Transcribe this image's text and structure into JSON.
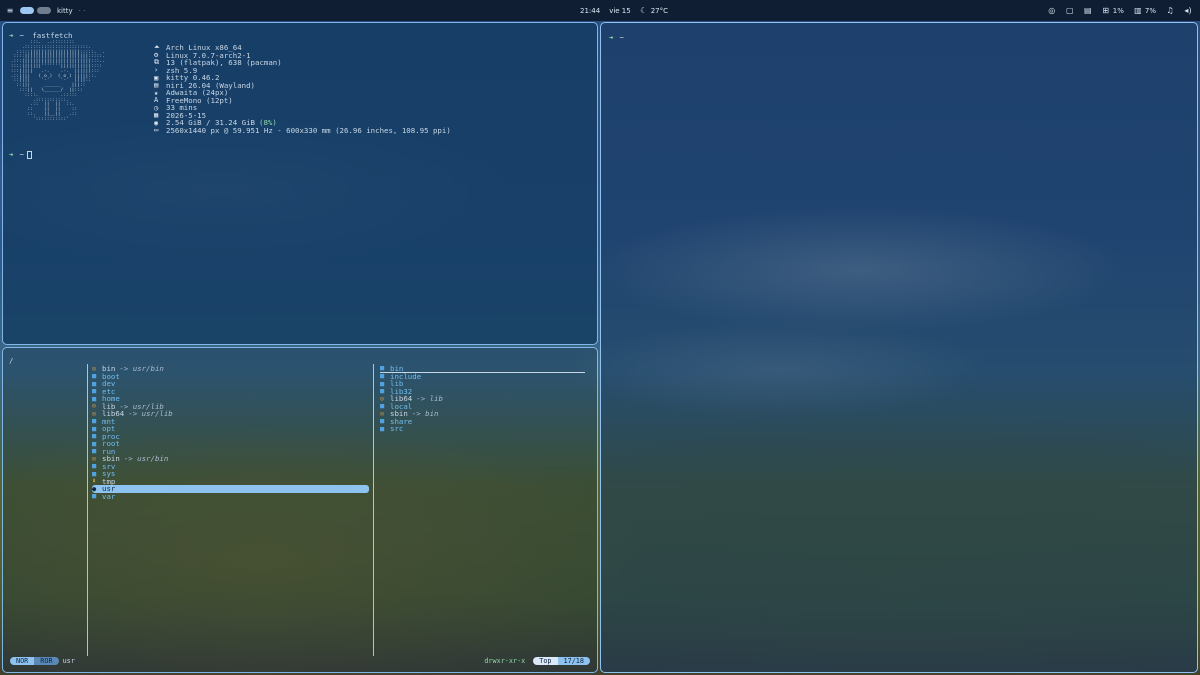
{
  "topbar": {
    "window_title": "kitty",
    "title_sep": "· ·",
    "clock": "21:44",
    "date": "vie 15",
    "weather": "27°C",
    "cpu": "1%",
    "memory": "7%",
    "icons": [
      "menu-icon",
      "screenshot-icon",
      "clipboard-icon",
      "notes-icon",
      "cpu-icon",
      "memory-icon",
      "notification-icon",
      "volume-icon"
    ]
  },
  "terminal_top_left": {
    "prompt_arrow": "➜",
    "prompt_dir": "~",
    "command": "fastfetch",
    "ascii_art": "        :::.  ..::::::::\n     .:::::::::::::::::::::::.\n   :::::||||||||||||||||||:::::.  .\n  ::::|||||||||||||||||||||||:::::.\n .:::|||||||||||||||||||||||||:::..\n ::::|||||||'''''''|||||||||||::::\n :::|||||   .-.    .-.  ||||||:::\n .::||||   ( o )  ( o ) |||||::.\n  ::||||    '-'    '-'  ||||::\n   ::|||     ______    |||::\n    :::||   \\______/  ||:::\n      ::::.        .:::::\n         .:::::::::::.\n        .::  ||  ||  ::.\n       ::    ||  ||    ::\n       ::.   ||__||   .::\n         ':::::::::::'",
    "info": [
      {
        "icon": "arch-icon",
        "glyph": "⏶",
        "text": "Arch Linux x86_64"
      },
      {
        "icon": "kernel-icon",
        "glyph": "⚙",
        "text": "Linux 7.0.7-arch2-1"
      },
      {
        "icon": "packages-icon",
        "glyph": "⧉",
        "text": "13 (flatpak), 638 (pacman)"
      },
      {
        "icon": "shell-icon",
        "glyph": "›",
        "text": "zsh 5.9"
      },
      {
        "icon": "terminal-icon",
        "glyph": "▣",
        "text": "kitty 0.46.2"
      },
      {
        "icon": "wm-icon",
        "glyph": "▤",
        "text": "niri 26.04 (Wayland)"
      },
      {
        "icon": "theme-icon",
        "glyph": "★",
        "text": "Adwaita (24px)"
      },
      {
        "icon": "font-icon",
        "glyph": "A",
        "text": "FreeMono (12pt)"
      },
      {
        "icon": "uptime-icon",
        "glyph": "◷",
        "text": "33 mins"
      },
      {
        "icon": "calendar-icon",
        "glyph": "▦",
        "text": "2026-5-15"
      },
      {
        "icon": "memory-icon",
        "glyph": "◉",
        "text": "2.54 GiB / 31.24 GiB",
        "pct": "(8%)"
      },
      {
        "icon": "display-icon",
        "glyph": "▭",
        "text": "2560x1440 px @ 59.951 Hz - 600x330 mm (26.96 inches, 108.95 ppi)"
      }
    ],
    "prompt2_dir": "~"
  },
  "terminal_right": {
    "prompt_arrow": "➜",
    "prompt_dir": "~"
  },
  "file_manager": {
    "path": "/",
    "parent_entries": [
      {
        "name": "bin",
        "type": "link",
        "target": "-> usr/bin"
      },
      {
        "name": "boot",
        "type": "dir"
      },
      {
        "name": "dev",
        "type": "dir"
      },
      {
        "name": "etc",
        "type": "dir"
      },
      {
        "name": "home",
        "type": "dir"
      },
      {
        "name": "lib",
        "type": "link",
        "target": "-> usr/lib"
      },
      {
        "name": "lib64",
        "type": "link",
        "target": "-> usr/lib"
      },
      {
        "name": "mnt",
        "type": "dir"
      },
      {
        "name": "opt",
        "type": "dir"
      },
      {
        "name": "proc",
        "type": "dir"
      },
      {
        "name": "root",
        "type": "dir"
      },
      {
        "name": "run",
        "type": "dir"
      },
      {
        "name": "sbin",
        "type": "link",
        "target": "-> usr/bin"
      },
      {
        "name": "srv",
        "type": "dir"
      },
      {
        "name": "sys",
        "type": "dir"
      },
      {
        "name": "tmp",
        "type": "tmp"
      },
      {
        "name": "usr",
        "type": "selected"
      },
      {
        "name": "var",
        "type": "dir"
      }
    ],
    "preview_entries": [
      {
        "name": "bin",
        "type": "dir",
        "highlight": true
      },
      {
        "name": "include",
        "type": "dir"
      },
      {
        "name": "lib",
        "type": "dir"
      },
      {
        "name": "lib32",
        "type": "dir"
      },
      {
        "name": "lib64",
        "type": "link",
        "target": "-> lib"
      },
      {
        "name": "local",
        "type": "dir"
      },
      {
        "name": "sbin",
        "type": "link",
        "target": "-> bin"
      },
      {
        "name": "share",
        "type": "dir"
      },
      {
        "name": "src",
        "type": "dir"
      }
    ],
    "status": {
      "mode": "NOR",
      "mode_secondary": "ROR",
      "current": "usr",
      "permissions": "drwxr-xr-x",
      "position_a": "Top",
      "position_b": "17/18"
    }
  }
}
